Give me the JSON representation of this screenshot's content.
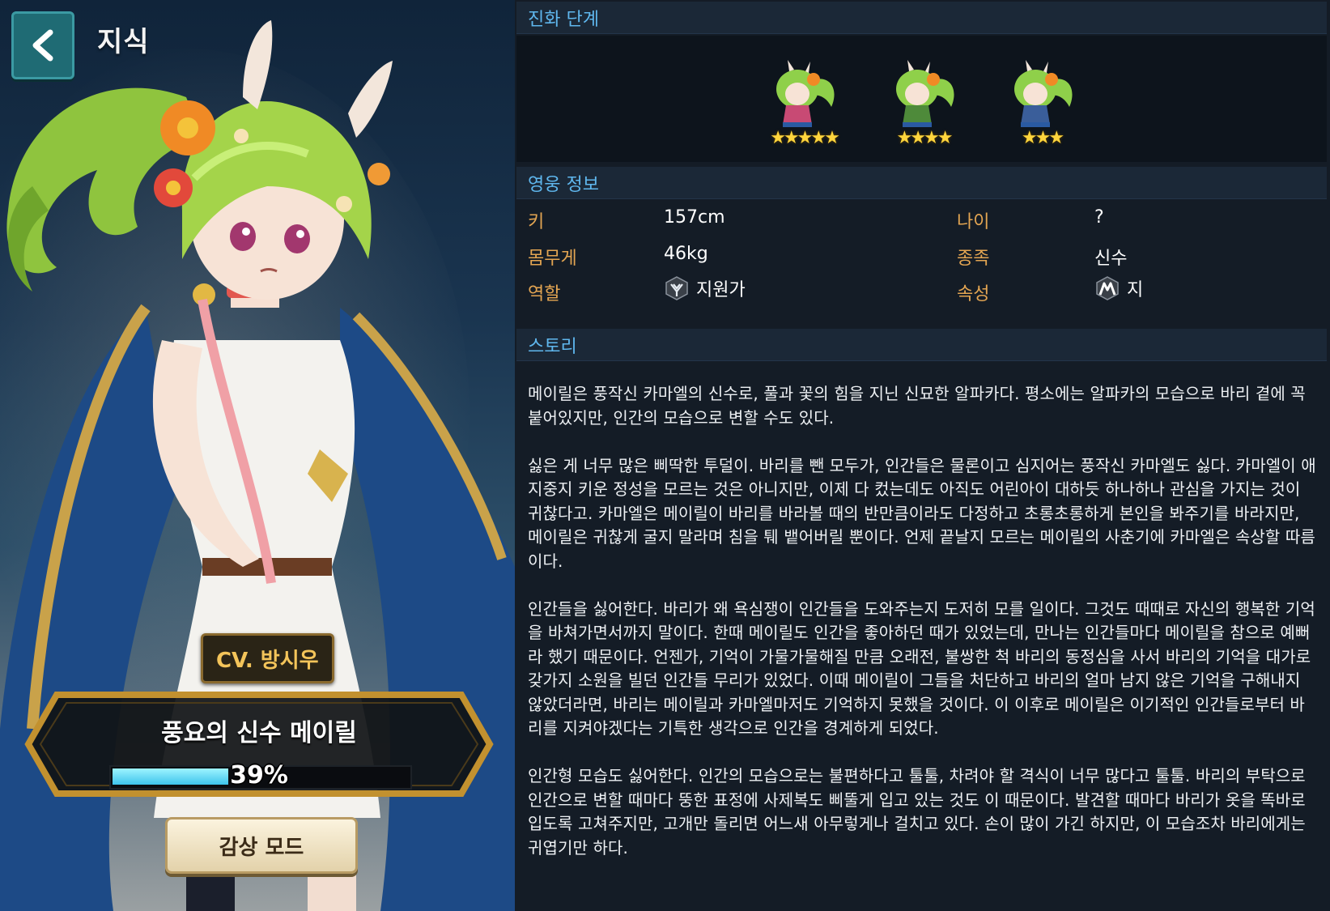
{
  "header": {
    "title": "지식",
    "back_icon": "chevron-left-icon"
  },
  "hero": {
    "cv": "CV. 방시우",
    "name": "풍요의 신수 메이릴",
    "progress": 39,
    "progress_label": "39%",
    "view_mode_label": "감상 모드"
  },
  "evolution": {
    "heading": "진화 단계",
    "stages": [
      {
        "stars": "★★★★★",
        "star_count": 5,
        "icon": "chibi-hero-icon"
      },
      {
        "stars": "★★★★",
        "star_count": 4,
        "icon": "chibi-hero-icon"
      },
      {
        "stars": "★★★",
        "star_count": 3,
        "icon": "chibi-hero-icon"
      }
    ]
  },
  "hero_info": {
    "heading": "영웅 정보",
    "height_label": "키",
    "height_value": "157cm",
    "age_label": "나이",
    "age_value": "?",
    "weight_label": "몸무게",
    "weight_value": "46kg",
    "race_label": "종족",
    "race_value": "신수",
    "role_label": "역할",
    "role_value": "지원가",
    "role_icon": "supporter-icon",
    "attribute_label": "속성",
    "attribute_value": "지",
    "attribute_icon": "earth-attribute-icon"
  },
  "story": {
    "heading": "스토리",
    "paragraphs": [
      "메이릴은 풍작신 카마엘의 신수로, 풀과 꽃의 힘을 지닌 신묘한 알파카다. 평소에는 알파카의 모습으로 바리 곁에 꼭 붙어있지만, 인간의 모습으로 변할 수도 있다.",
      "싫은 게 너무 많은 삐딱한 투덜이. 바리를 뺀 모두가, 인간들은 물론이고 심지어는 풍작신 카마엘도 싫다. 카마엘이 애지중지 키운 정성을 모르는 것은 아니지만, 이제 다 컸는데도 아직도 어린아이 대하듯 하나하나 관심을 가지는 것이 귀찮다고. 카마엘은 메이릴이 바리를 바라볼 때의 반만큼이라도 다정하고 초롱초롱하게 본인을 봐주기를 바라지만, 메이릴은 귀찮게 굴지 말라며 침을 퉤 뱉어버릴 뿐이다. 언제 끝날지 모르는 메이릴의 사춘기에 카마엘은 속상할 따름이다.",
      "인간들을 싫어한다. 바리가 왜 욕심쟁이 인간들을 도와주는지 도저히 모를 일이다. 그것도 때때로 자신의 행복한 기억을 바쳐가면서까지 말이다. 한때 메이릴도 인간을 좋아하던 때가 있었는데, 만나는 인간들마다 메이릴을 참으로 예뻐라 했기 때문이다. 언젠가, 기억이 가물가물해질 만큼 오래전, 불쌍한 척 바리의 동정심을 사서 바리의 기억을 대가로 갖가지 소원을 빌던 인간들 무리가 있었다. 이때 메이릴이 그들을 처단하고 바리의 얼마 남지 않은 기억을 구해내지 않았더라면, 바리는 메이릴과 카마엘마저도 기억하지 못했을 것이다. 이 이후로 메이릴은 이기적인 인간들로부터 바리를 지켜야겠다는 기특한 생각으로 인간을 경계하게 되었다.",
      "인간형 모습도 싫어한다. 인간의 모습으로는 불편하다고 툴툴, 차려야 할 격식이 너무 많다고 툴툴. 바리의 부탁으로 인간으로 변할 때마다 뚱한 표정에 사제복도 삐뚤게 입고 있는 것도 이 때문이다. 발견할 때마다 바리가 옷을 똑바로 입도록 고쳐주지만, 고개만 돌리면 어느새 아무렇게나 걸치고 있다. 손이 많이 가긴 하지만, 이 모습조차 바리에게는 귀엽기만 하다."
    ]
  },
  "colors": {
    "accent_blue": "#5fb7ee",
    "label_orange": "#e3a552",
    "progress_fill": "#3ec4ec",
    "star_gold": "#ffd53d",
    "back_button": "#1f6b74"
  }
}
